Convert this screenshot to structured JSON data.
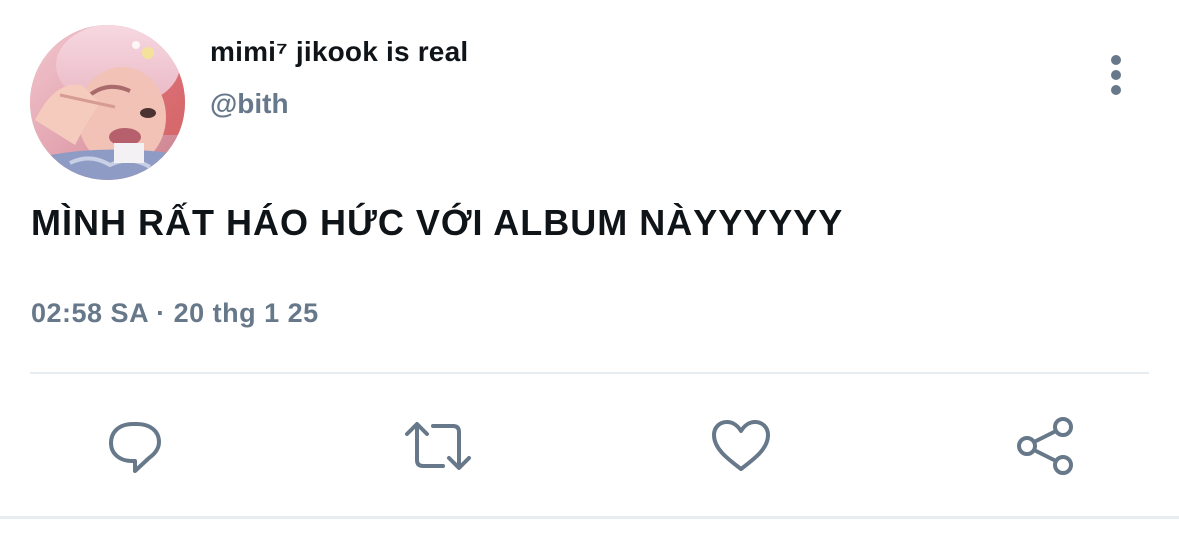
{
  "tweet": {
    "display_name": "mimi⁷ jikook is real",
    "handle": "@bith",
    "text": "MÌNH RẤT HÁO HỨC VỚI ALBUM NÀYYYYYY",
    "timestamp": "02:58 SA",
    "separator": "·",
    "date": "20 thg 1 25"
  },
  "icons": {
    "more": "more-vertical-icon",
    "reply": "reply-icon",
    "retweet": "retweet-icon",
    "like": "heart-icon",
    "share": "share-icon"
  },
  "colors": {
    "text_primary": "#0f1419",
    "text_secondary": "#66788a",
    "divider": "#e6ecf0"
  }
}
